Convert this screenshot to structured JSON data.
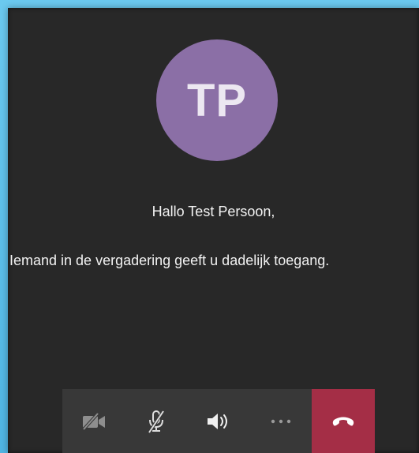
{
  "avatar": {
    "initials": "TP",
    "color": "#8b6fa6"
  },
  "greeting": "Hallo Test Persoon,",
  "lobby_message": "Iemand in de vergadering geeft u dadelijk toegang.",
  "call_controls": [
    {
      "name": "camera-off-icon",
      "state": "off"
    },
    {
      "name": "microphone-off-icon",
      "state": "muted"
    },
    {
      "name": "speaker-icon",
      "state": "on"
    },
    {
      "name": "more-options-icon"
    },
    {
      "name": "hang-up-icon",
      "color": "#a42e46"
    }
  ],
  "colors": {
    "background": "#282828",
    "callbar": "#383838",
    "hangup": "#a42e46",
    "frame": "#5fc1ea"
  }
}
